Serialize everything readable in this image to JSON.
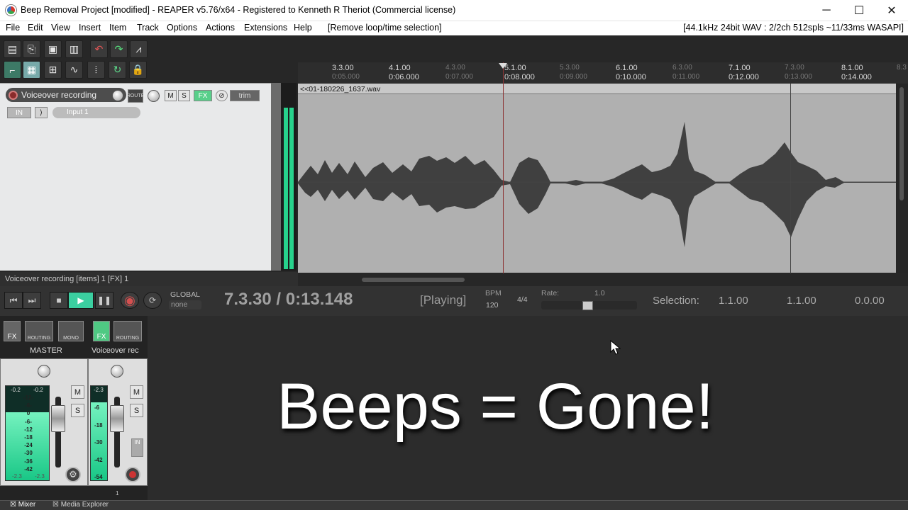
{
  "window": {
    "title": "Beep Removal Project [modified] - REAPER v5.76/x64 - Registered to Kenneth R Theriot (Commercial license)",
    "controls": {
      "minimize": "─",
      "maximize": "☐",
      "close": "✕"
    }
  },
  "menubar": {
    "items": [
      "File",
      "Edit",
      "View",
      "Insert",
      "Item",
      "Track",
      "Options",
      "Actions",
      "Extensions",
      "Help",
      "[Remove loop/time selection]"
    ],
    "audio_info": "[44.1kHz 24bit WAV : 2/2ch 512spls ~11/33ms WASAPI]"
  },
  "tcp": {
    "track_name": "Voiceover recording",
    "route_label": "ROUTE",
    "mute_label": "M",
    "solo_label": "S",
    "fx_label": "FX",
    "trim_label": "trim",
    "input_label": "IN",
    "input_name": "Input 1",
    "track_number": "1",
    "status": "Voiceover recording [items] 1 [FX] 1"
  },
  "ruler": {
    "ticks": [
      {
        "major": "3.3.00",
        "sub": "0:05.000"
      },
      {
        "major": "4.1.00",
        "sub": "0:06.000"
      },
      {
        "major": "4.3.00",
        "sub": "0:07.000"
      },
      {
        "major": "5.1.00",
        "sub": "0:08.000"
      },
      {
        "major": "5.3.00",
        "sub": "0:09.000"
      },
      {
        "major": "6.1.00",
        "sub": "0:10.000"
      },
      {
        "major": "6.3.00",
        "sub": "0:11.000"
      },
      {
        "major": "7.1.00",
        "sub": "0:12.000"
      },
      {
        "major": "7.3.00",
        "sub": "0:13.000"
      },
      {
        "major": "8.1.00",
        "sub": "0:14.000"
      },
      {
        "major": "8.3",
        "sub": ""
      }
    ]
  },
  "item": {
    "filename": "<<01-180226_1637.wav"
  },
  "transport": {
    "global_label": "GLOBAL",
    "none_label": "none",
    "time": "7.3.30 / 0:13.148",
    "state": "[Playing]",
    "bpm_label": "BPM",
    "bpm_value": "120",
    "timesig": "4/4",
    "rate_label": "Rate:",
    "rate_value": "1.0",
    "selection_label": "Selection:",
    "sel_start": "1.1.00",
    "sel_end": "1.1.00",
    "sel_length": "0.0.00"
  },
  "mixer": {
    "master_label": "MASTER",
    "track_label": "Voiceover rec",
    "fx": "FX",
    "routing": "ROUTING",
    "mono": "MONO",
    "mute": "M",
    "solo": "S",
    "in": "IN",
    "master_peak_l": "-0.2",
    "master_peak_r": "-0.2",
    "master_low_l": "-2.3",
    "master_low_r": "-2.3",
    "track_peak": "-2.3",
    "track_number": "1",
    "meter_scale": [
      "-12-",
      "-6-",
      "0",
      "-6-",
      "-12",
      "-18",
      "-24",
      "-30",
      "-36",
      "-42"
    ],
    "track_scale": [
      "-6",
      "-18",
      "-30",
      "-42",
      "-54"
    ],
    "master_level": 0.72,
    "track_level": 0.83
  },
  "tabs": {
    "mixer": "Mixer",
    "media_explorer": "Media Explorer"
  },
  "caption": "Beeps = Gone!",
  "colors": {
    "accent": "#18c985",
    "rec": "#b93636",
    "play": "#3bcfa0"
  }
}
